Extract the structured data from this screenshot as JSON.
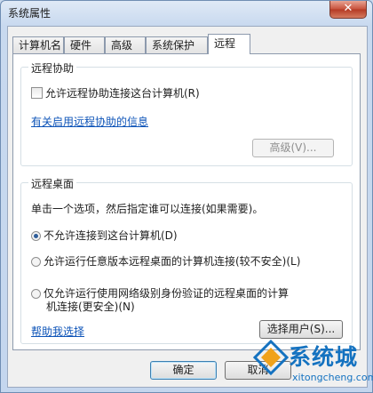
{
  "window": {
    "title": "系统属性",
    "close_glyph": "✕"
  },
  "tabs": [
    {
      "label": "计算机名",
      "active": false
    },
    {
      "label": "硬件",
      "active": false
    },
    {
      "label": "高级",
      "active": false
    },
    {
      "label": "系统保护",
      "active": false
    },
    {
      "label": "远程",
      "active": true
    }
  ],
  "remote_assistance": {
    "group_label": "远程协助",
    "allow_checkbox_label": "允许远程协助连接这台计算机(R)",
    "allow_checked": false,
    "info_link": "有关启用远程协助的信息",
    "advanced_button": "高级(V)..."
  },
  "remote_desktop": {
    "group_label": "远程桌面",
    "instruction": "单击一个选项，然后指定谁可以连接(如果需要)。",
    "options": [
      {
        "label": "不允许连接到这台计算机(D)",
        "selected": true
      },
      {
        "label": "允许运行任意版本远程桌面的计算机连接(较不安全)(L)",
        "selected": false
      },
      {
        "label_line1": "仅允许运行使用网络级别身份验证的远程桌面的计算",
        "label_line2": "机连接(更安全)(N)",
        "selected": false
      }
    ],
    "help_link": "帮助我选择",
    "select_users_button": "选择用户(S)..."
  },
  "footer": {
    "ok_button": "确定",
    "cancel_button": "取消"
  },
  "watermark": {
    "text": "系统城",
    "sub": "xitongcheng.com"
  }
}
